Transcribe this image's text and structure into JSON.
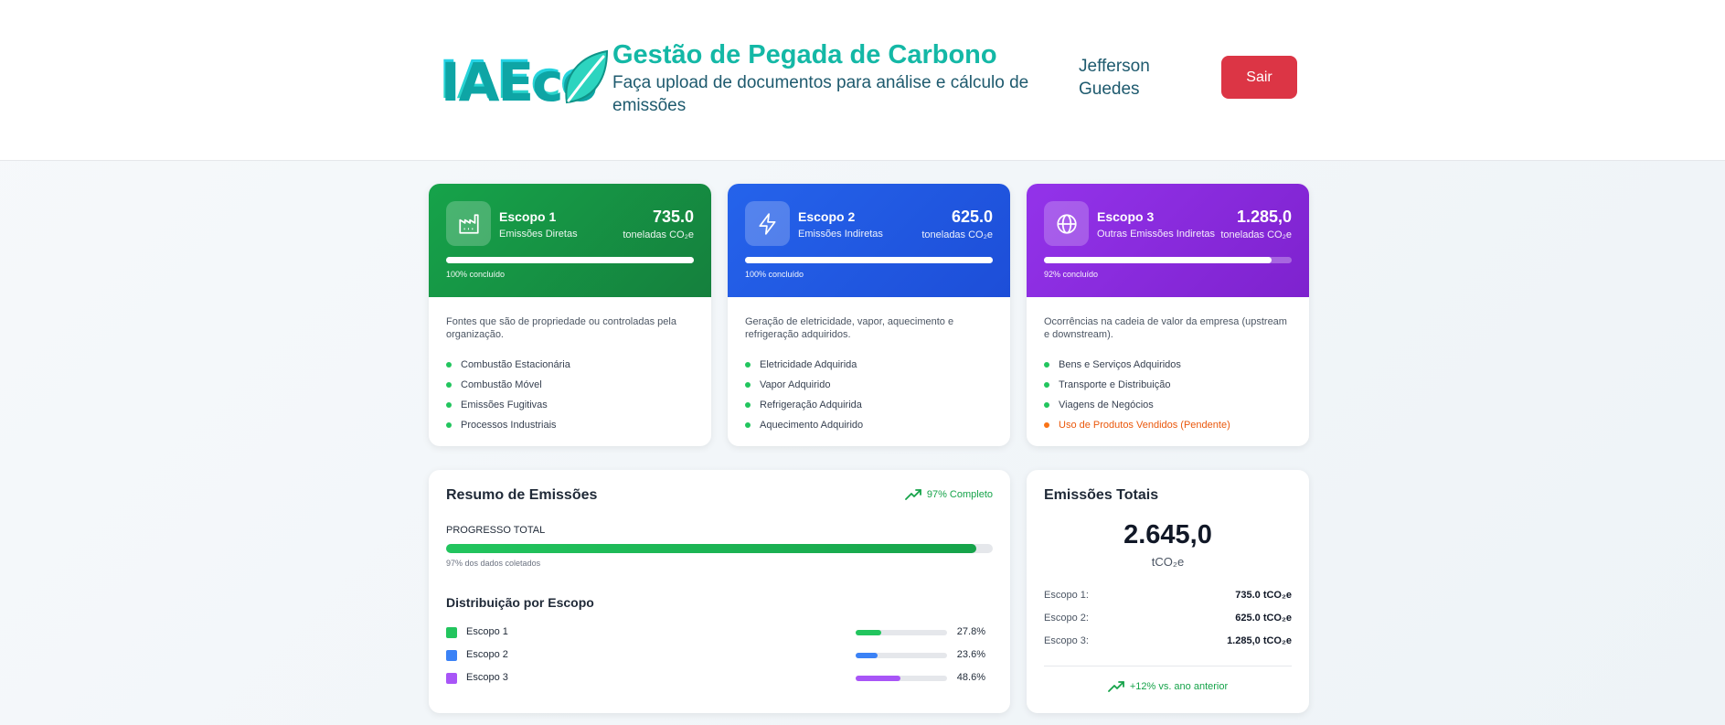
{
  "header": {
    "logo_text": "IAEco",
    "title": "Gestão de Pegada de Carbono",
    "subtitle": "Faça upload de documentos para análise e cálculo de emissões",
    "username": "Jefferson Guedes",
    "logout_label": "Sair"
  },
  "scopes": [
    {
      "name": "Escopo 1",
      "description": "Emissões Diretas",
      "value": "735.0",
      "unit": "toneladas CO₂e",
      "progress": 100,
      "progress_label": "100% concluído",
      "icon": "factory-icon",
      "color": "#16a34a",
      "text": "Fontes que são de propriedade ou controladas pela organização.",
      "items": [
        "Combustão Estacionária",
        "Combustão Móvel",
        "Emissões Fugitivas",
        "Processos Industriais"
      ]
    },
    {
      "name": "Escopo 2",
      "description": "Emissões Indiretas",
      "value": "625.0",
      "unit": "toneladas CO₂e",
      "progress": 100,
      "progress_label": "100% concluído",
      "icon": "lightning-icon",
      "color": "#2563eb",
      "text": "Geração de eletricidade, vapor, aquecimento e refrigeração adquiridos.",
      "items": [
        "Eletricidade Adquirida",
        "Vapor Adquirido",
        "Refrigeração Adquirida",
        "Aquecimento Adquirido"
      ]
    },
    {
      "name": "Escopo 3",
      "description": "Outras Emissões Indiretas",
      "value": "1.285,0",
      "unit": "toneladas CO₂e",
      "progress": 92,
      "progress_label": "92% concluído",
      "icon": "globe-icon",
      "color": "#9333ea",
      "text": "Ocorrências na cadeia de valor da empresa (upstream e downstream).",
      "items": [
        "Bens e Serviços Adquiridos",
        "Transporte e Distribuição",
        "Viagens de Negócios",
        "Uso de Produtos Vendidos (Pendente)"
      ],
      "pending_item": "Uso de Produtos Vendidos (Pendente)"
    }
  ],
  "summary": {
    "title": "Resumo de Emissões",
    "complete_label": "97% Completo",
    "progress_label": "PROGRESSO TOTAL",
    "progress": 97,
    "progress_note": "97% dos dados coletados",
    "distribution_title": "Distribuição por Escopo",
    "distribution": [
      {
        "name": "Escopo 1",
        "percent": 27.8,
        "percent_label": "27.8%",
        "color": "#22c55e"
      },
      {
        "name": "Escopo 2",
        "percent": 23.6,
        "percent_label": "23.6%",
        "color": "#3b82f6"
      },
      {
        "name": "Escopo 3",
        "percent": 48.6,
        "percent_label": "48.6%",
        "color": "#a855f7"
      }
    ]
  },
  "totals": {
    "title": "Emissões Totais",
    "value": "2.645,0",
    "unit": "tCO₂e",
    "rows": [
      {
        "label": "Escopo 1:",
        "value": "735.0 tCO₂e"
      },
      {
        "label": "Escopo 2:",
        "value": "625.0 tCO₂e"
      },
      {
        "label": "Escopo 3:",
        "value": "1.285,0 tCO₂e"
      }
    ],
    "growth": "+12% vs. ano anterior"
  }
}
